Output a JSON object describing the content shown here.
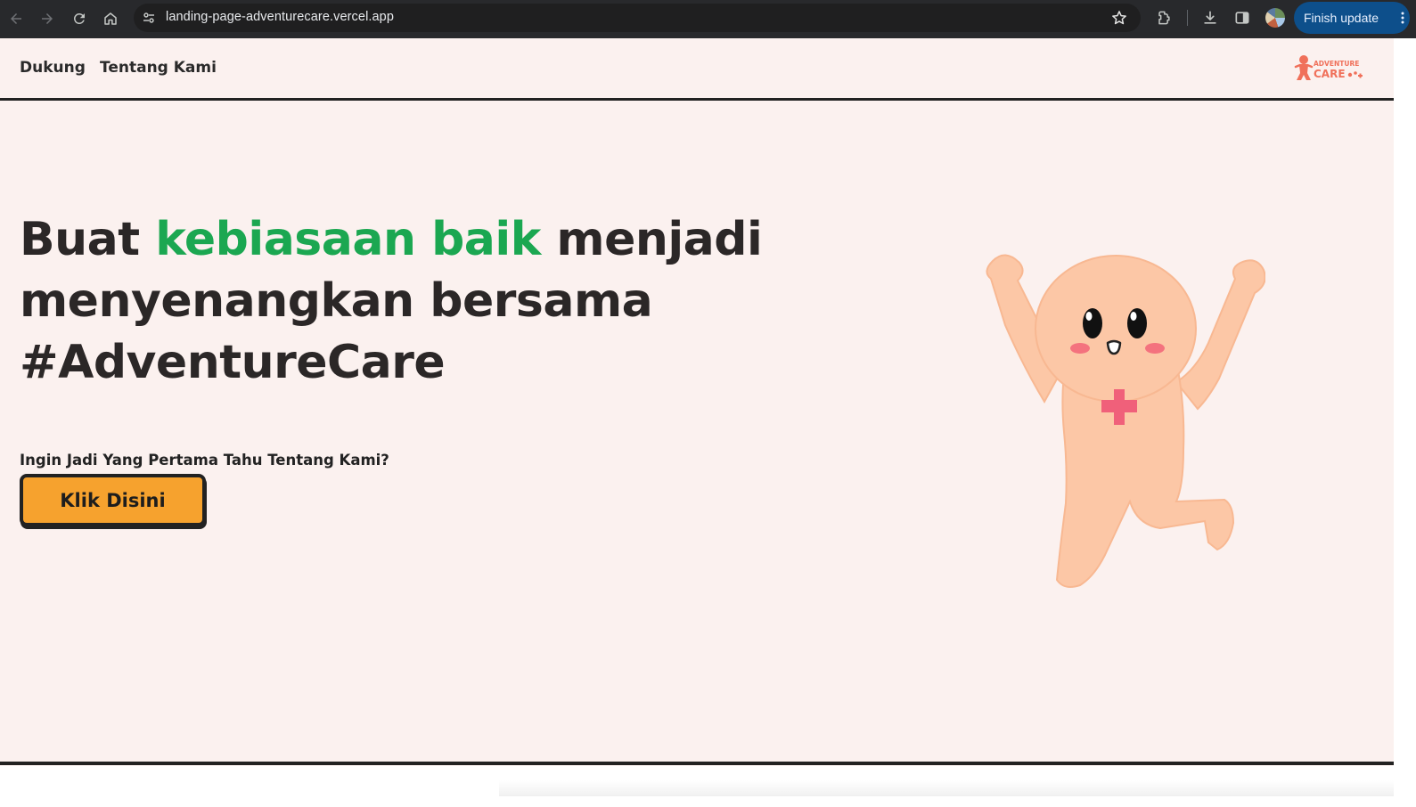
{
  "browser": {
    "url": "landing-page-adventurecare.vercel.app",
    "finish_update_label": "Finish update",
    "icons": {
      "back": "arrow-left-icon",
      "forward": "arrow-right-icon",
      "reload": "reload-icon",
      "home": "home-icon",
      "site_info": "tune-icon",
      "bookmark": "star-icon",
      "extensions": "puzzle-icon",
      "downloads": "download-icon",
      "side_panel": "side-panel-icon",
      "profile": "avatar-icon",
      "menu": "more-vert-icon"
    }
  },
  "nav": {
    "items": [
      {
        "label": "Dukung"
      },
      {
        "label": "Tentang Kami"
      }
    ],
    "logo": {
      "word1": "ADVENTURE",
      "word2": "CARE"
    }
  },
  "hero": {
    "title_part1": "Buat ",
    "title_highlight": "kebiasaan baik",
    "title_part2": " menjadi menyenangkan bersama #AdventureCare",
    "cta_question": "Ingin Jadi Yang Pertama Tahu Tentang Kami?",
    "cta_button": "Klik Disini"
  },
  "colors": {
    "page_bg": "#fbf1ef",
    "highlight": "#1ba751",
    "text": "#2b2727",
    "cta_bg": "#f6a22e",
    "mascot_skin": "#fcc7a6",
    "cross": "#f0607a",
    "update_button": "#0d4f8b"
  }
}
